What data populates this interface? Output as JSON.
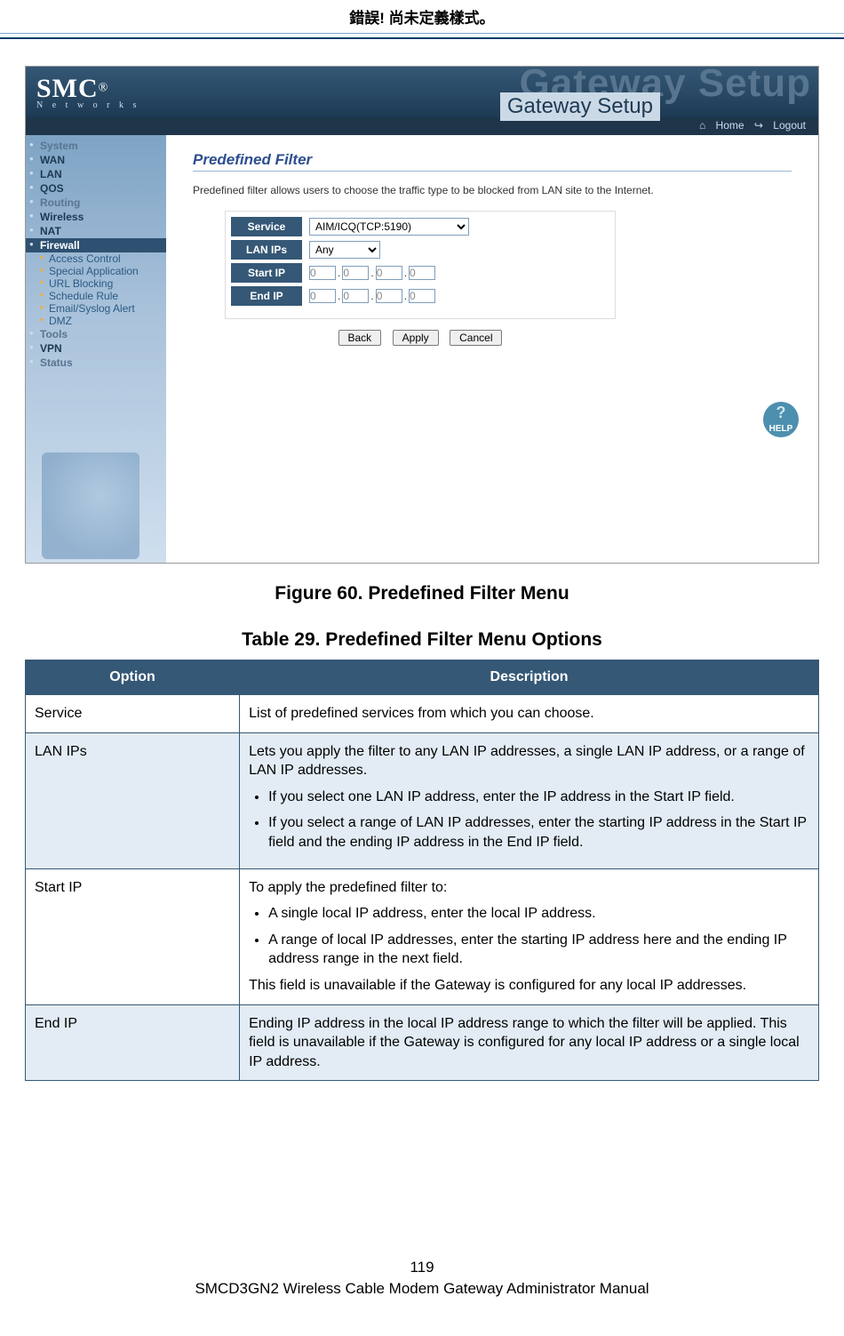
{
  "header_text": "錯誤! 尚未定義樣式。",
  "router": {
    "logo_main": "SMC",
    "logo_reg": "®",
    "logo_sub": "N e t w o r k s",
    "ghost_title": "Gateway Setup",
    "setup_tag": "Gateway Setup",
    "link_home": "Home",
    "link_logout": "Logout",
    "nav": {
      "system": "System",
      "wan": "WAN",
      "lan": "LAN",
      "qos": "QOS",
      "routing": "Routing",
      "wireless": "Wireless",
      "nat": "NAT",
      "firewall": "Firewall",
      "ac": "Access Control",
      "sa": "Special Application",
      "ub": "URL Blocking",
      "sr": "Schedule Rule",
      "es": "Email/Syslog Alert",
      "dmz": "DMZ",
      "tools": "Tools",
      "vpn": "VPN",
      "status": "Status"
    },
    "panel_title": "Predefined Filter",
    "panel_intro": "Predefined filter allows users to choose the traffic type to be blocked from LAN site to the Internet.",
    "labels": {
      "service": "Service",
      "lanips": "LAN IPs",
      "startip": "Start IP",
      "endip": "End IP"
    },
    "values": {
      "service_sel": "AIM/ICQ(TCP:5190)",
      "lanips_sel": "Any",
      "ip_octet": "0"
    },
    "buttons": {
      "back": "Back",
      "apply": "Apply",
      "cancel": "Cancel"
    },
    "help": "HELP"
  },
  "figure_caption": "Figure 60. Predefined Filter Menu",
  "table_caption": "Table 29. Predefined Filter Menu Options",
  "table": {
    "head_option": "Option",
    "head_desc": "Description",
    "rows": {
      "r1_opt": "Service",
      "r1_desc": "List of predefined services from which you can choose.",
      "r2_opt": "LAN IPs",
      "r2_lead": "Lets you apply the filter to any LAN IP addresses, a single LAN IP address, or a range of LAN IP addresses.",
      "r2_b1": "If you select one LAN IP address, enter the IP address in the Start IP field.",
      "r2_b2": "If you select a range of LAN IP addresses, enter the starting IP address in the Start IP field and the ending IP address in the End IP field.",
      "r3_opt": "Start IP",
      "r3_lead": "To apply the predefined filter to:",
      "r3_b1": "A single local IP address, enter the local IP address.",
      "r3_b2": "A range of local IP addresses, enter the starting IP address here and the ending IP address range in the next field.",
      "r3_tail": "This field is unavailable if the Gateway is configured for any local IP addresses.",
      "r4_opt": "End IP",
      "r4_desc": "Ending IP address in the local IP address range to which the filter will be applied. This field is unavailable if the Gateway is configured for any local IP address or a single local IP address."
    }
  },
  "footer": {
    "page": "119",
    "title": "SMCD3GN2 Wireless Cable Modem Gateway Administrator Manual"
  }
}
